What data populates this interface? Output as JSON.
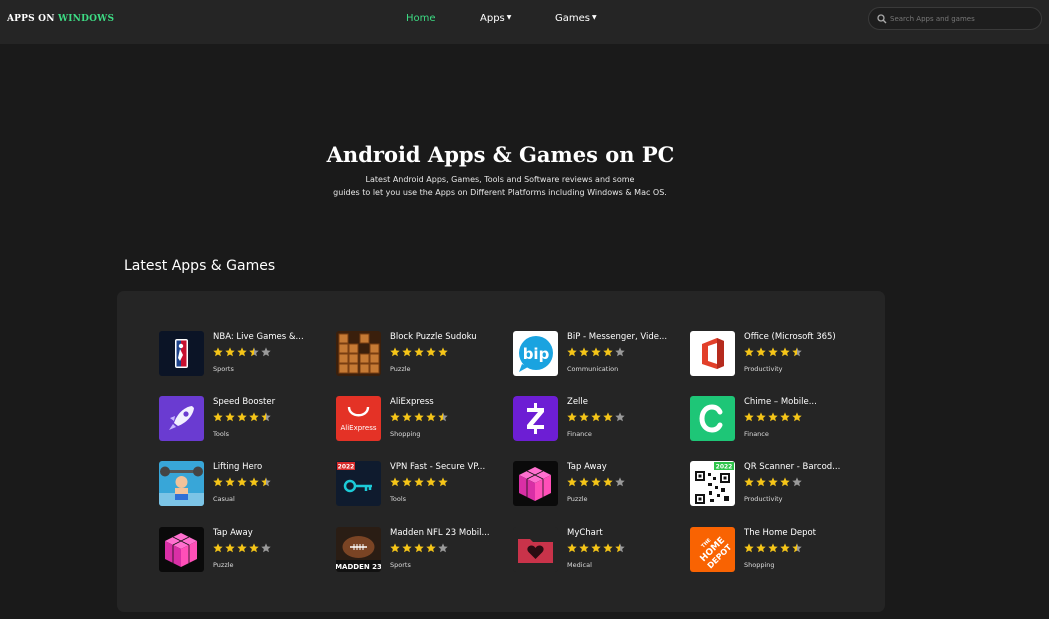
{
  "brand": {
    "prefix": "APPS ON",
    "accent": "WINDOWS"
  },
  "nav": {
    "home": "Home",
    "apps": "Apps",
    "games": "Games",
    "search_placeholder": "Search Apps and games"
  },
  "hero": {
    "title": "Android Apps & Games on PC",
    "subtitle_line1": "Latest Android Apps, Games, Tools and Software reviews and some",
    "subtitle_line2": "guides to let you use the Apps on Different Platforms including Windows & Mac OS."
  },
  "section": {
    "title": "Latest Apps & Games"
  },
  "colors": {
    "accent": "#3ddc84",
    "star": "#f5c518",
    "star_empty": "#9a9a9a",
    "background": "#1a1a1a",
    "panel": "#252525"
  },
  "apps": [
    {
      "name": "NBA: Live Games &...",
      "rating": 3.5,
      "category": "Sports",
      "icon": "nba-logo-icon"
    },
    {
      "name": "Block Puzzle Sudoku",
      "rating": 5,
      "category": "Puzzle",
      "icon": "wood-blocks-icon"
    },
    {
      "name": "BiP - Messenger, Vide...",
      "rating": 4,
      "category": "Communication",
      "icon": "bip-bubble-icon"
    },
    {
      "name": "Office (Microsoft 365)",
      "rating": 4.5,
      "category": "Productivity",
      "icon": "office-logo-icon"
    },
    {
      "name": "Speed Booster",
      "rating": 4.5,
      "category": "Tools",
      "icon": "rocket-icon"
    },
    {
      "name": "AliExpress",
      "rating": 4.5,
      "category": "Shopping",
      "icon": "aliexpress-bag-icon"
    },
    {
      "name": "Zelle",
      "rating": 4,
      "category": "Finance",
      "icon": "zelle-z-icon"
    },
    {
      "name": "Chime – Mobile...",
      "rating": 5,
      "category": "Finance",
      "icon": "chime-c-icon"
    },
    {
      "name": "Lifting Hero",
      "rating": 4.5,
      "category": "Casual",
      "icon": "weightlifter-icon"
    },
    {
      "name": "VPN Fast - Secure VP...",
      "rating": 5,
      "category": "Tools",
      "icon": "vpn-key-icon"
    },
    {
      "name": "Tap Away",
      "rating": 4,
      "category": "Puzzle",
      "icon": "pink-cube-icon"
    },
    {
      "name": "QR Scanner - Barcod...",
      "rating": 4,
      "category": "Productivity",
      "icon": "qr-code-icon"
    },
    {
      "name": "Tap Away",
      "rating": 4,
      "category": "Puzzle",
      "icon": "pink-cube-icon"
    },
    {
      "name": "Madden NFL 23 Mobil...",
      "rating": 4,
      "category": "Sports",
      "icon": "madden-football-icon"
    },
    {
      "name": "MyChart",
      "rating": 4.5,
      "category": "Medical",
      "icon": "folder-heart-icon"
    },
    {
      "name": "The Home Depot",
      "rating": 4.5,
      "category": "Shopping",
      "icon": "home-depot-logo-icon"
    }
  ]
}
